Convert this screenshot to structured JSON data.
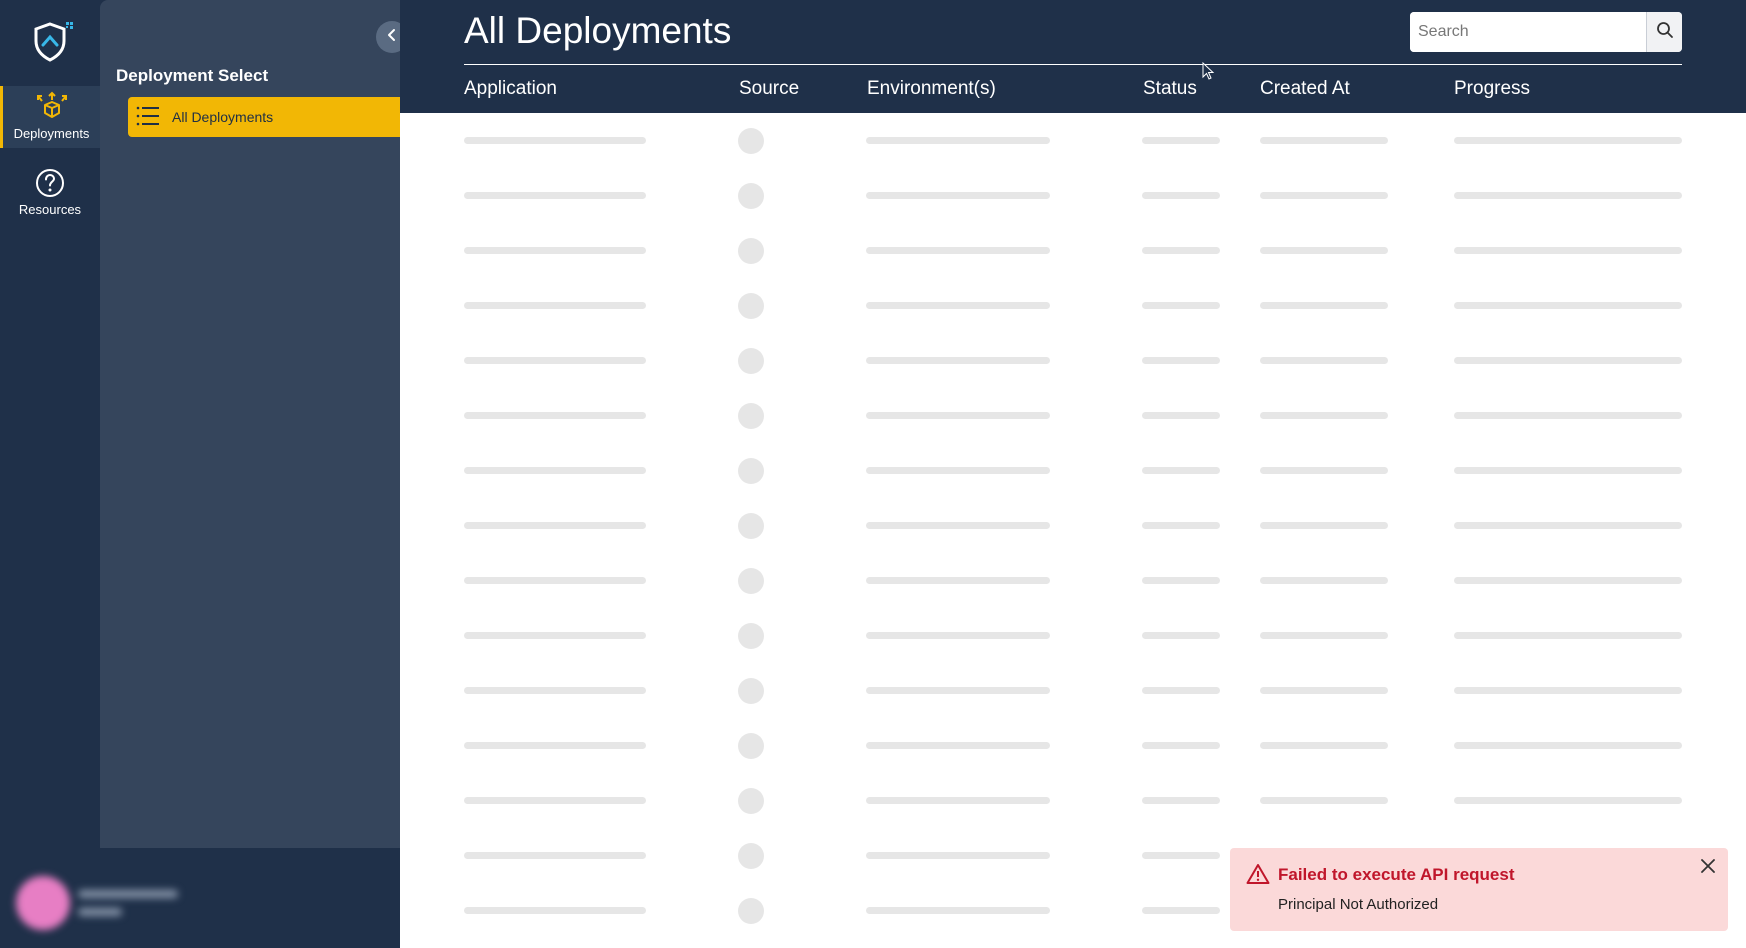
{
  "rail": {
    "items": [
      {
        "label": "Deployments",
        "icon": "deployments-icon",
        "active": true
      },
      {
        "label": "Resources",
        "icon": "help-circle-icon",
        "active": false
      }
    ]
  },
  "panel": {
    "title": "Deployment Select",
    "items": [
      {
        "label": "All Deployments",
        "icon": "list-icon",
        "active": true
      }
    ]
  },
  "main": {
    "title": "All Deployments",
    "search": {
      "placeholder": "Search",
      "value": ""
    },
    "columns": [
      "Application",
      "Source",
      "Environment(s)",
      "Status",
      "Created At",
      "Progress"
    ],
    "loading": true
  },
  "toast": {
    "type": "error",
    "title": "Failed to execute API request",
    "message": "Principal Not Authorized"
  },
  "colors": {
    "navy": "#1f3049",
    "panel": "#35455c",
    "accent": "#f2b705",
    "skeleton": "#e6e6e6",
    "error": "#c0162b",
    "error_bg": "#fbd9d9"
  }
}
